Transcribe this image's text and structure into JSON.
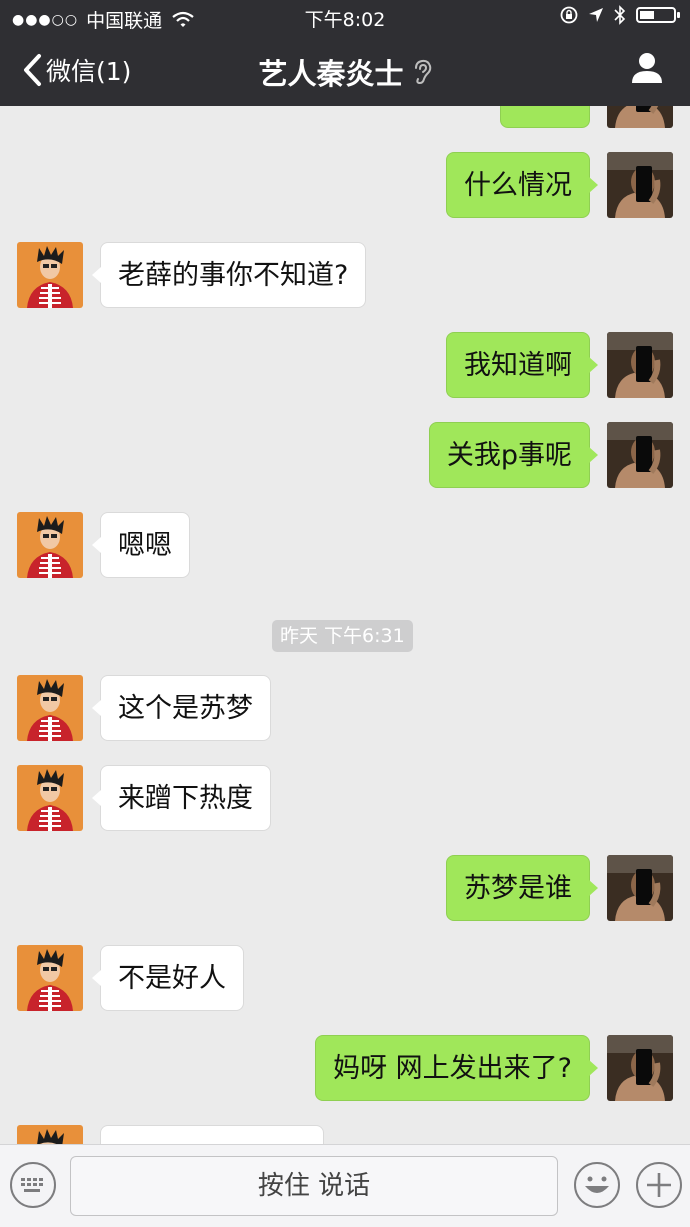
{
  "status_bar": {
    "signal": "●●●○○",
    "carrier": "中国联通",
    "time": "下午8:02"
  },
  "nav": {
    "back_label": "微信(1)",
    "title": "艺人秦炎士"
  },
  "messages": [
    {
      "side": "out",
      "text": ""
    },
    {
      "side": "out",
      "text": "什么情况"
    },
    {
      "side": "in",
      "text": "老薛的事你不知道?"
    },
    {
      "side": "out",
      "text": "我知道啊"
    },
    {
      "side": "out",
      "text": "关我p事呢"
    },
    {
      "side": "in",
      "text": "嗯嗯"
    },
    {
      "side": "in",
      "text": "这个是苏梦"
    },
    {
      "side": "in",
      "text": "来蹭下热度"
    },
    {
      "side": "out",
      "text": "苏梦是谁"
    },
    {
      "side": "in",
      "text": "不是好人"
    },
    {
      "side": "out",
      "text": "妈呀 网上发出来了?"
    },
    {
      "side": "in",
      "text": ""
    }
  ],
  "timestamp": "昨天 下午6:31",
  "input_bar": {
    "voice_label": "按住 说话"
  },
  "colors": {
    "bar_bg": "#2f2f33",
    "chat_bg": "#ebebeb",
    "bubble_out": "#a0e75a",
    "bubble_in": "#ffffff",
    "avatar_in_bg": "#e8903a",
    "avatar_out_bg": "#3a2d22"
  },
  "icons": {
    "back": "chevron-left-icon",
    "earpiece": "ear-icon",
    "profile": "person-icon",
    "keyboard": "keyboard-icon",
    "emoji": "smiley-icon",
    "plus": "plus-icon"
  }
}
